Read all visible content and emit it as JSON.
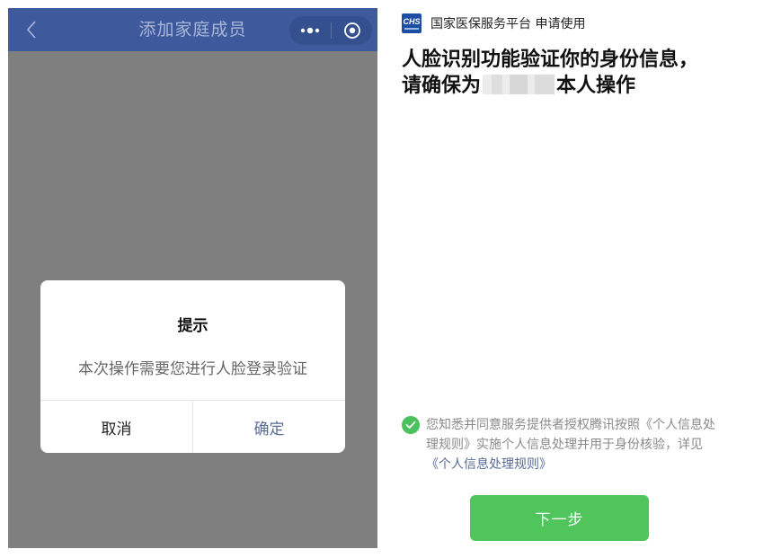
{
  "left": {
    "nav": {
      "title": "添加家庭成员",
      "back_icon": "chevron-left-icon",
      "more_icon": "more-dots-icon",
      "close_icon": "target-close-icon"
    },
    "dialog": {
      "title": "提示",
      "message": "本次操作需要您进行人脸登录验证",
      "cancel_label": "取消",
      "confirm_label": "确定"
    },
    "colors": {
      "nav_bg": "#3f5a9c",
      "overlay": "#7f7f7f",
      "confirm": "#576b95"
    }
  },
  "right": {
    "header": {
      "logo_text": "CHS",
      "app_name": "国家医保服务平台 申请使用"
    },
    "heading": {
      "part1": "人脸识别功能验证你的身份信息，请确保为",
      "part2": "本人操作"
    },
    "consent": {
      "checked": true,
      "text1": "您知悉并同意服务提供者授权腾讯按照",
      "link1": "《个人信息处理规则》",
      "text2": "实施个人信息处理并用于身份核验，详见 ",
      "link2": "《个人信息处理规则》"
    },
    "next_button_label": "下一步",
    "colors": {
      "accent_green": "#4fc55c",
      "link": "#576b95"
    }
  }
}
